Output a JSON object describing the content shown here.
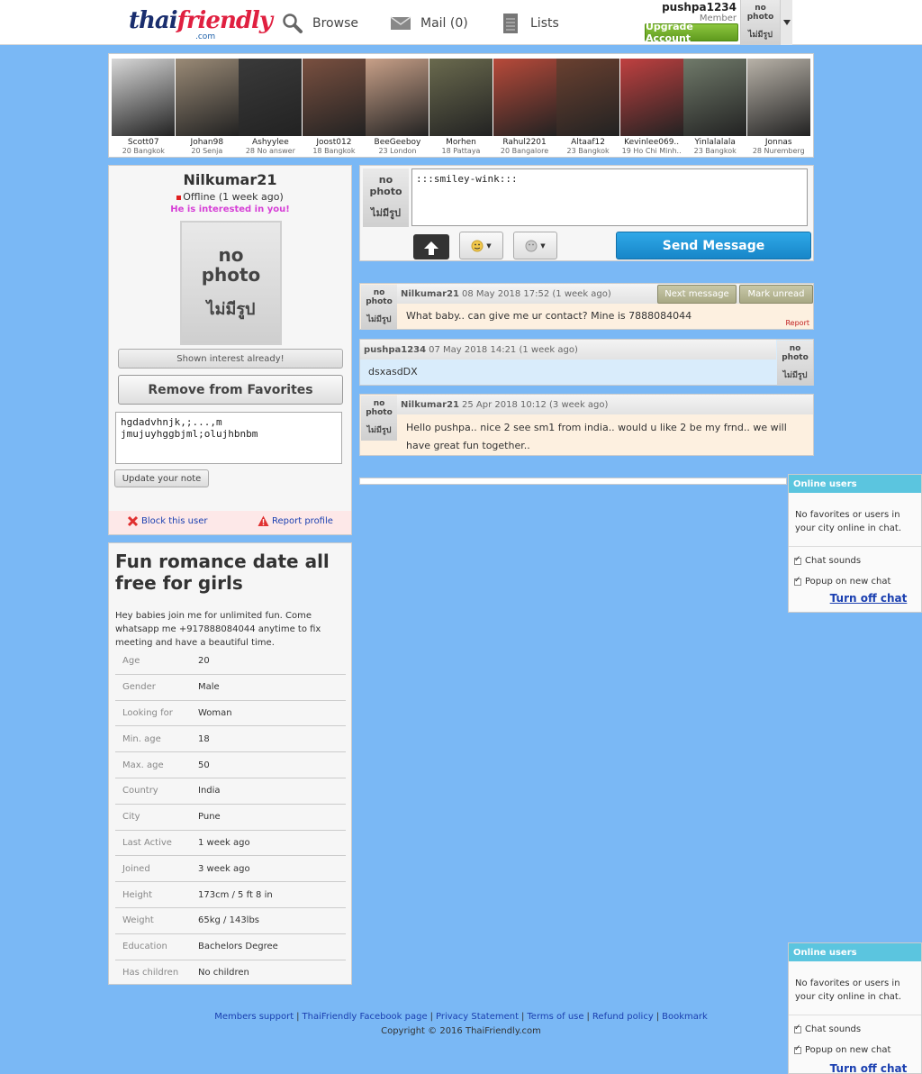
{
  "header": {
    "logo": {
      "part1": "thai",
      "part2": "friendly",
      "com": ".com"
    },
    "nav": [
      {
        "label": "Browse",
        "icon": "magnifier-icon"
      },
      {
        "label": "Mail (0)",
        "icon": "envelope-icon"
      },
      {
        "label": "Lists",
        "icon": "notepad-icon"
      }
    ],
    "user": {
      "name": "pushpa1234",
      "role": "Member",
      "upgrade_label": "Upgrade Account"
    }
  },
  "no_photo": {
    "en": "no photo",
    "th": "ไม่มีรูป"
  },
  "strip": [
    {
      "name": "Scott07",
      "info": "20 Bangkok",
      "color": "#d8d8d8"
    },
    {
      "name": "Johan98",
      "info": "20 Senja",
      "color": "#9a8a76"
    },
    {
      "name": "Ashyylee",
      "info": "28 No answer",
      "color": "#3a3a3a"
    },
    {
      "name": "Joost012",
      "info": "18 Bangkok",
      "color": "#7a5040"
    },
    {
      "name": "BeeGeeboy",
      "info": "23 London",
      "color": "#c8a088"
    },
    {
      "name": "Morhen",
      "info": "18 Pattaya",
      "color": "#6a6a4e"
    },
    {
      "name": "Rahul2201",
      "info": "20 Bangalore",
      "color": "#b84a3a"
    },
    {
      "name": "Altaaf12",
      "info": "23 Bangkok",
      "color": "#6a4030"
    },
    {
      "name": "Kevinlee069..",
      "info": "19 Ho Chi Minh..",
      "color": "#c04040"
    },
    {
      "name": "Yinlalalala",
      "info": "23 Bangkok",
      "color": "#707a6a"
    },
    {
      "name": "Jonnas",
      "info": "28 Nuremberg",
      "color": "#b8b2a8"
    }
  ],
  "profile": {
    "name": "Nilkumar21",
    "status": "Offline (1 week ago)",
    "interest": "He is interested in you!",
    "shown_interest_label": "Shown interest already!",
    "remove_fav_label": "Remove from Favorites",
    "note": "hgdadvhnjk,;...,m jmujuyhggbjml;olujhbnbm",
    "update_note_label": "Update your note",
    "block_label": "Block this user",
    "report_label": "Report profile"
  },
  "about": {
    "title": "Fun romance date all free for girls",
    "body": "Hey babies join me for unlimited fun. Come whatsapp me +917888084044 anytime to fix meeting and have a beautiful time.",
    "details": [
      {
        "label": "Age",
        "value": "20"
      },
      {
        "label": "Gender",
        "value": "Male"
      },
      {
        "label": "Looking for",
        "value": "Woman"
      },
      {
        "label": "Min. age",
        "value": "18"
      },
      {
        "label": "Max. age",
        "value": "50"
      },
      {
        "label": "Country",
        "value": "India"
      },
      {
        "label": "City",
        "value": "Pune"
      },
      {
        "label": "Last Active",
        "value": "1 week ago"
      },
      {
        "label": "Joined",
        "value": "3 week ago"
      },
      {
        "label": "Height",
        "value": "173cm / 5 ft 8 in"
      },
      {
        "label": "Weight",
        "value": "65kg / 143lbs"
      },
      {
        "label": "Education",
        "value": "Bachelors Degree"
      },
      {
        "label": "Has children",
        "value": "No children"
      }
    ]
  },
  "compose": {
    "message": ":::smiley-wink:::",
    "send_label": "Send Message"
  },
  "messages": [
    {
      "sender": "Nilkumar21",
      "time": "08 May 2018 17:52 (1 week ago)",
      "text": "What baby.. can give me ur contact? Mine is 7888084044",
      "next_label": "Next message",
      "mark_unread_label": "Mark unread",
      "report_label": "Report"
    },
    {
      "sender": "pushpa1234",
      "time": "07 May 2018 14:21 (1 week ago)",
      "text": "dsxasdDX"
    },
    {
      "sender": "Nilkumar21",
      "time": "25 Apr 2018 10:12 (3 week ago)",
      "text": "Hello pushpa.. nice 2 see sm1 from india.. would u like 2 be my frnd.. we will have great fun together.."
    }
  ],
  "online_widget": {
    "title": "Online users",
    "message": "No favorites or users in your city online in chat.",
    "chat_sounds": "Chat sounds",
    "popup": "Popup on new chat",
    "turn_off": "Turn off chat"
  },
  "footer": {
    "links": [
      "Members support",
      "ThaiFriendly Facebook page",
      "Privacy Statement",
      "Terms of use",
      "Refund policy",
      "Bookmark"
    ],
    "copyright": "Copyright © 2016 ThaiFriendly.com"
  }
}
